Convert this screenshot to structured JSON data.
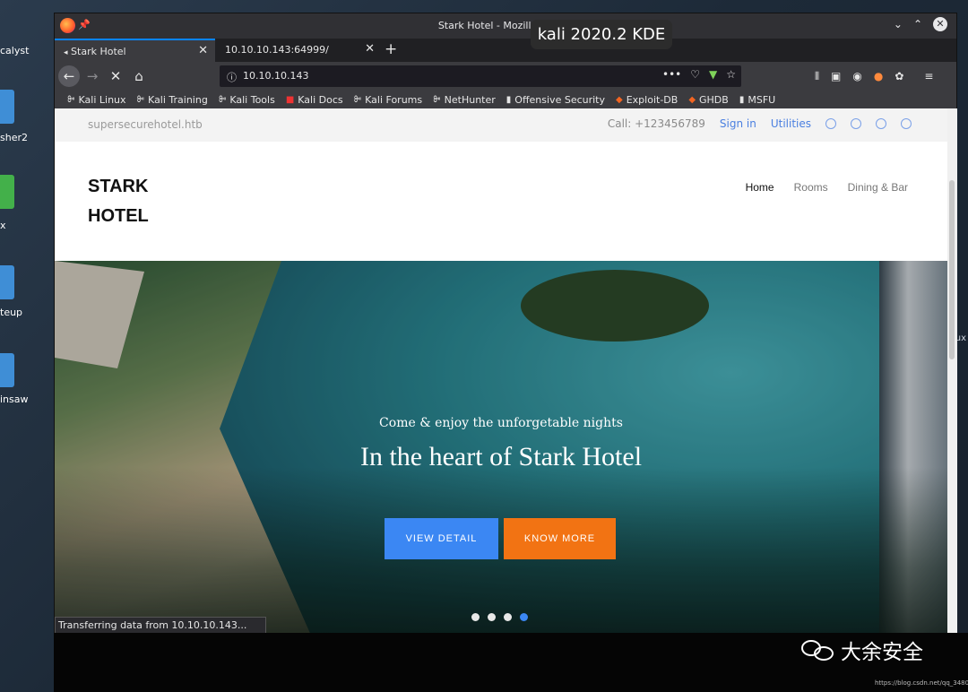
{
  "desktop": {
    "icons": [
      "calyst",
      "sher2",
      "x",
      "teup",
      "insaw"
    ],
    "right_text": "ux"
  },
  "window": {
    "title": "Stark Hotel - Mozilla Firefox",
    "overlay": "kali 2020.2 KDE"
  },
  "tabs": [
    {
      "label": "Stark Hotel"
    },
    {
      "label": "10.10.10.143:64999/"
    }
  ],
  "nav": {
    "url": "10.10.10.143"
  },
  "bookmarks": [
    "Kali Linux",
    "Kali Training",
    "Kali Tools",
    "Kali Docs",
    "Kali Forums",
    "NetHunter",
    "Offensive Security",
    "Exploit-DB",
    "GHDB",
    "MSFU"
  ],
  "site": {
    "domain": "supersecurehotel.htb",
    "call": "Call: +123456789",
    "sign_in": "Sign in",
    "utilities": "Utilities",
    "brand_line1": "STARK",
    "brand_line2": "HOTEL",
    "menu": [
      "Home",
      "Rooms",
      "Dining & Bar"
    ],
    "hero_sub": "Come & enjoy the unforgetable nights",
    "hero_title": "In the heart of Stark Hotel",
    "btn_detail": "VIEW DETAIL",
    "btn_more": "KNOW MORE",
    "slide_count": 4,
    "active_slide": 4
  },
  "status": "Transferring data from 10.10.10.143...",
  "watermark": {
    "text": "大余安全",
    "credit": "https://blog.csdn.net/qq_34801745"
  }
}
